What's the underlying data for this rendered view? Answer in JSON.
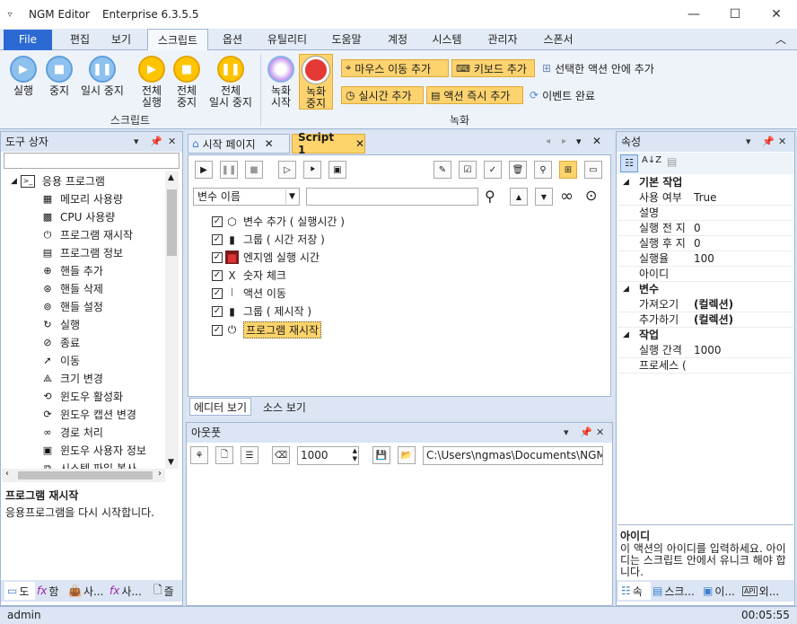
{
  "window": {
    "title": "NGM Editor",
    "edition": "Enterprise 6.3.5.5",
    "sysmenu": "▿",
    "min": "—",
    "max": "☐",
    "close": "✕"
  },
  "menu": [
    "File",
    "편집",
    "보기",
    "스크립트",
    "옵션",
    "유틸리티",
    "도움말",
    "계정",
    "시스템",
    "관리자",
    "스폰서"
  ],
  "menu_collapse": "︿",
  "ribbon": {
    "run": "실행",
    "stop": "중지",
    "pause": "일시 중지",
    "run_all_1": "전체",
    "run_all_2": "실행",
    "stop_all_1": "전체",
    "stop_all_2": "중지",
    "pause_all_1": "전체",
    "pause_all_2": "일시 중지",
    "group_script": "스크립트",
    "rec_1": "녹화",
    "rec_2": "시작",
    "recstop_1": "녹화",
    "recstop_2": "중지",
    "mouse_move": "마우스 이동 추가",
    "keyboard": "키보드 추가",
    "add_in_selected": "선택한 액션 안에 추가",
    "realtime": "실시간 추가",
    "action_now": "액션 즉시 추가",
    "event_done": "이벤트 완료",
    "group_record": "녹화"
  },
  "toolbox": {
    "title": "도구 상자",
    "root": "응용 프로그램",
    "items": [
      {
        "label": "메모리 사용량",
        "icon": "memory-icon"
      },
      {
        "label": "CPU 사용량",
        "icon": "cpu-icon"
      },
      {
        "label": "프로그램 재시작",
        "icon": "restart-icon"
      },
      {
        "label": "프로그램 정보",
        "icon": "info-icon"
      },
      {
        "label": "핸들 추가",
        "icon": "crosshair-icon"
      },
      {
        "label": "핸들 삭제",
        "icon": "handle-delete-icon"
      },
      {
        "label": "핸들 설정",
        "icon": "handle-set-icon"
      },
      {
        "label": "실행",
        "icon": "run-icon"
      },
      {
        "label": "종료",
        "icon": "exit-icon"
      },
      {
        "label": "이동",
        "icon": "move-icon"
      },
      {
        "label": "크기 변경",
        "icon": "resize-icon"
      },
      {
        "label": "윈도우 활성화",
        "icon": "activate-icon"
      },
      {
        "label": "윈도우 캡션 변경",
        "icon": "caption-icon"
      },
      {
        "label": "경로 처리",
        "icon": "path-icon"
      },
      {
        "label": "윈도우 사용자 정보",
        "icon": "user-icon"
      },
      {
        "label": "시스템 파일 복사",
        "icon": "copy-icon"
      }
    ],
    "desc_title": "프로그램 재시작",
    "desc_text": "응용프로그램을 다시 시작합니다.",
    "tabs": [
      "도",
      "함",
      "사...",
      "사...",
      "즐"
    ]
  },
  "editor": {
    "tabs": [
      "시작 페이지",
      "Script 1"
    ],
    "filter_select": "변수 이름",
    "actions": [
      {
        "label": "변수 추가 ( 실행시간 )",
        "icon": "variable-icon"
      },
      {
        "label": "그룹 ( 시간 저장 )",
        "icon": "group-icon"
      },
      {
        "label": "엔지엠 실행 시간",
        "icon": "ngm-icon"
      },
      {
        "label": "숫자 체크",
        "icon": "number-check-icon"
      },
      {
        "label": "액션 이동",
        "icon": "action-move-icon"
      },
      {
        "label": "그룹 ( 제시작 )",
        "icon": "group-icon"
      },
      {
        "label": "프로그램 재시작",
        "icon": "restart-icon"
      }
    ],
    "bottom_tabs": [
      "에디터 보기",
      "소스 보기"
    ]
  },
  "output": {
    "title": "아웃풋",
    "count": "1000",
    "path": "C:\\Users\\ngmas\\Documents\\NGM6\\"
  },
  "props": {
    "title": "속성",
    "cat_basic": "기본 작업",
    "rows_basic": [
      {
        "k": "사용 여부",
        "v": "True"
      },
      {
        "k": "설명",
        "v": ""
      },
      {
        "k": "실행 전 지",
        "v": "0"
      },
      {
        "k": "실행 후 지",
        "v": "0"
      },
      {
        "k": "실행율",
        "v": "100"
      },
      {
        "k": "아이디",
        "v": ""
      }
    ],
    "cat_var": "변수",
    "rows_var": [
      {
        "k": "가져오기",
        "v": "(컬렉션)"
      },
      {
        "k": "추가하기",
        "v": "(컬렉션)"
      }
    ],
    "cat_work": "작업",
    "rows_work": [
      {
        "k": "실행 간격",
        "v": "1000"
      },
      {
        "k": "프로세스 (",
        "v": ""
      }
    ],
    "desc_title": "아이디",
    "desc_text": "이 액션의 아이디를 입력하세요. 아이디는 스크립트 안에서 유니크 해야 합니다.",
    "tabs": [
      "속",
      "스크...",
      "이...",
      "외..."
    ]
  },
  "status": {
    "user": "admin",
    "time": "00:05:55"
  }
}
